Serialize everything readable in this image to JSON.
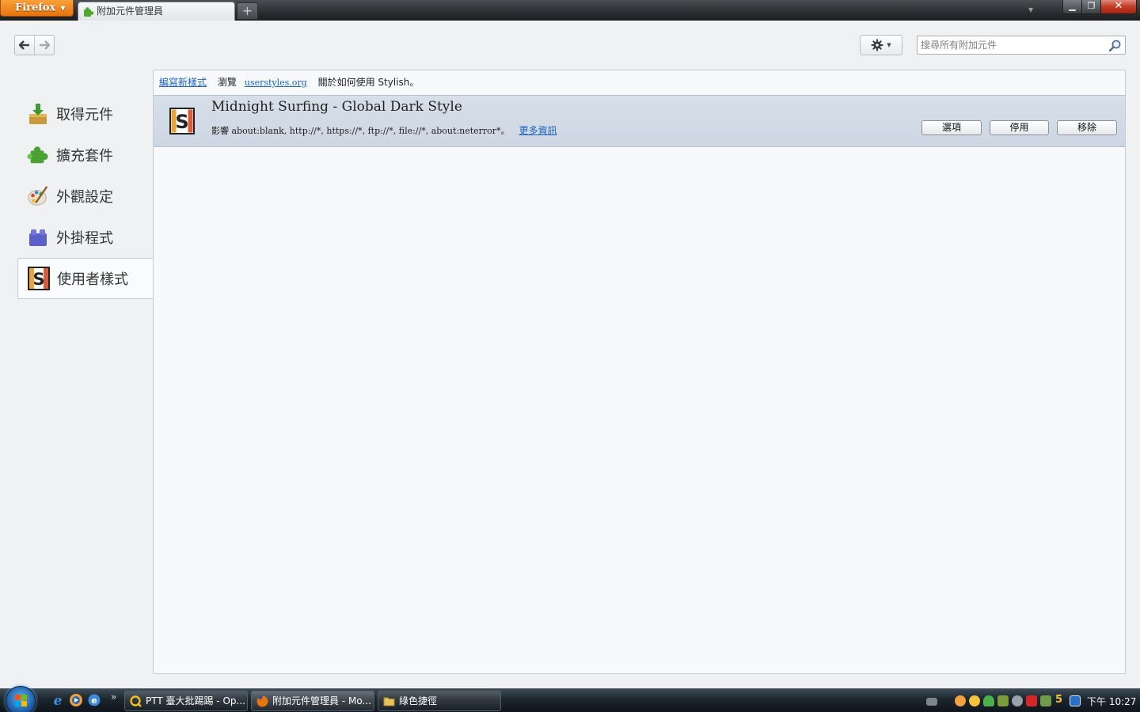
{
  "window": {
    "app_button": "Firefox",
    "tab_title": "附加元件管理員",
    "new_tab": "+",
    "min": "▁",
    "max": "❐",
    "close": "✕"
  },
  "toolbar": {
    "search_placeholder": "搜尋所有附加元件"
  },
  "sidebar": {
    "items": [
      {
        "label": "取得元件",
        "icon": "download-icon"
      },
      {
        "label": "擴充套件",
        "icon": "puzzle-icon"
      },
      {
        "label": "外觀設定",
        "icon": "palette-icon"
      },
      {
        "label": "外掛程式",
        "icon": "plugin-block-icon"
      },
      {
        "label": "使用者樣式",
        "icon": "stylish-icon",
        "selected": true
      }
    ]
  },
  "header": {
    "write_new": "編寫新樣式",
    "browse": "瀏覽",
    "userstyles": "userstyles.org",
    "about": "關於如何使用 Stylish。"
  },
  "item": {
    "name": "Midnight Surfing - Global Dark Style",
    "affects": "影響 about:blank, http://*, https://*, ftp://*, file://*, about:neterror*。",
    "more_info": "更多資訊",
    "buttons": {
      "options": "選項",
      "disable": "停用",
      "remove": "移除"
    }
  },
  "taskbar": {
    "more": "»",
    "tasks": [
      {
        "label": "PTT 臺大批踢踢 - Op..."
      },
      {
        "label": "附加元件管理員 - Mo..."
      },
      {
        "label": "綠色捷徑"
      }
    ],
    "tray_number": "5",
    "clock": "下午 10:27"
  },
  "colors": {
    "accent_link": "#1e63c2",
    "firefox_orange": "#e8740c",
    "selected_item_bg": "#cdd6e2"
  }
}
